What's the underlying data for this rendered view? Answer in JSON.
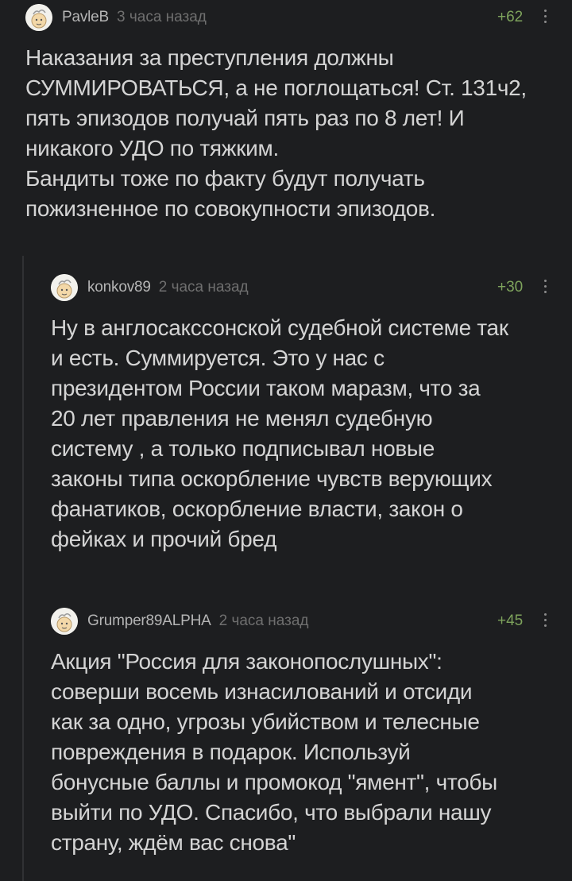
{
  "comments": [
    {
      "author": "PavleB",
      "time": "3 часа назад",
      "rating": "+62",
      "text": "Наказания за преступления должны\nСУММИРОВАТЬСЯ, а не поглощаться! Ст. 131ч2,\nпять эпизодов получай пять раз по 8 лет! И\nникакого УДО по тяжким.\nБандиты тоже по факту будут получать\nпожизненное по совокупности эпизодов."
    },
    {
      "author": "konkov89",
      "time": "2 часа назад",
      "rating": "+30",
      "text": "Ну в англосакссонской судебной системе так\nи есть. Суммируется. Это у нас с\nпрезидентом России таком маразм, что за\n20 лет правления не менял судебную\nсистему , а только подписывал новые\nзаконы типа оскорбление чувств верующих\nфанатиков, оскорбление власти, закон о\nфейках и прочий бред"
    },
    {
      "author": "Grumper89ALPHA",
      "time": "2 часа назад",
      "rating": "+45",
      "text": "Акция \"Россия для законопослушных\":\nсоверши восемь изнасилований и отсиди\nкак за одно, угрозы убийством и телесные\nповреждения в подарок. Используй\nбонусные баллы и промокод \"ямент\", чтобы\nвыйти по УДО. Спасибо, что выбрали нашу\nстрану, ждём вас снова\""
    }
  ]
}
